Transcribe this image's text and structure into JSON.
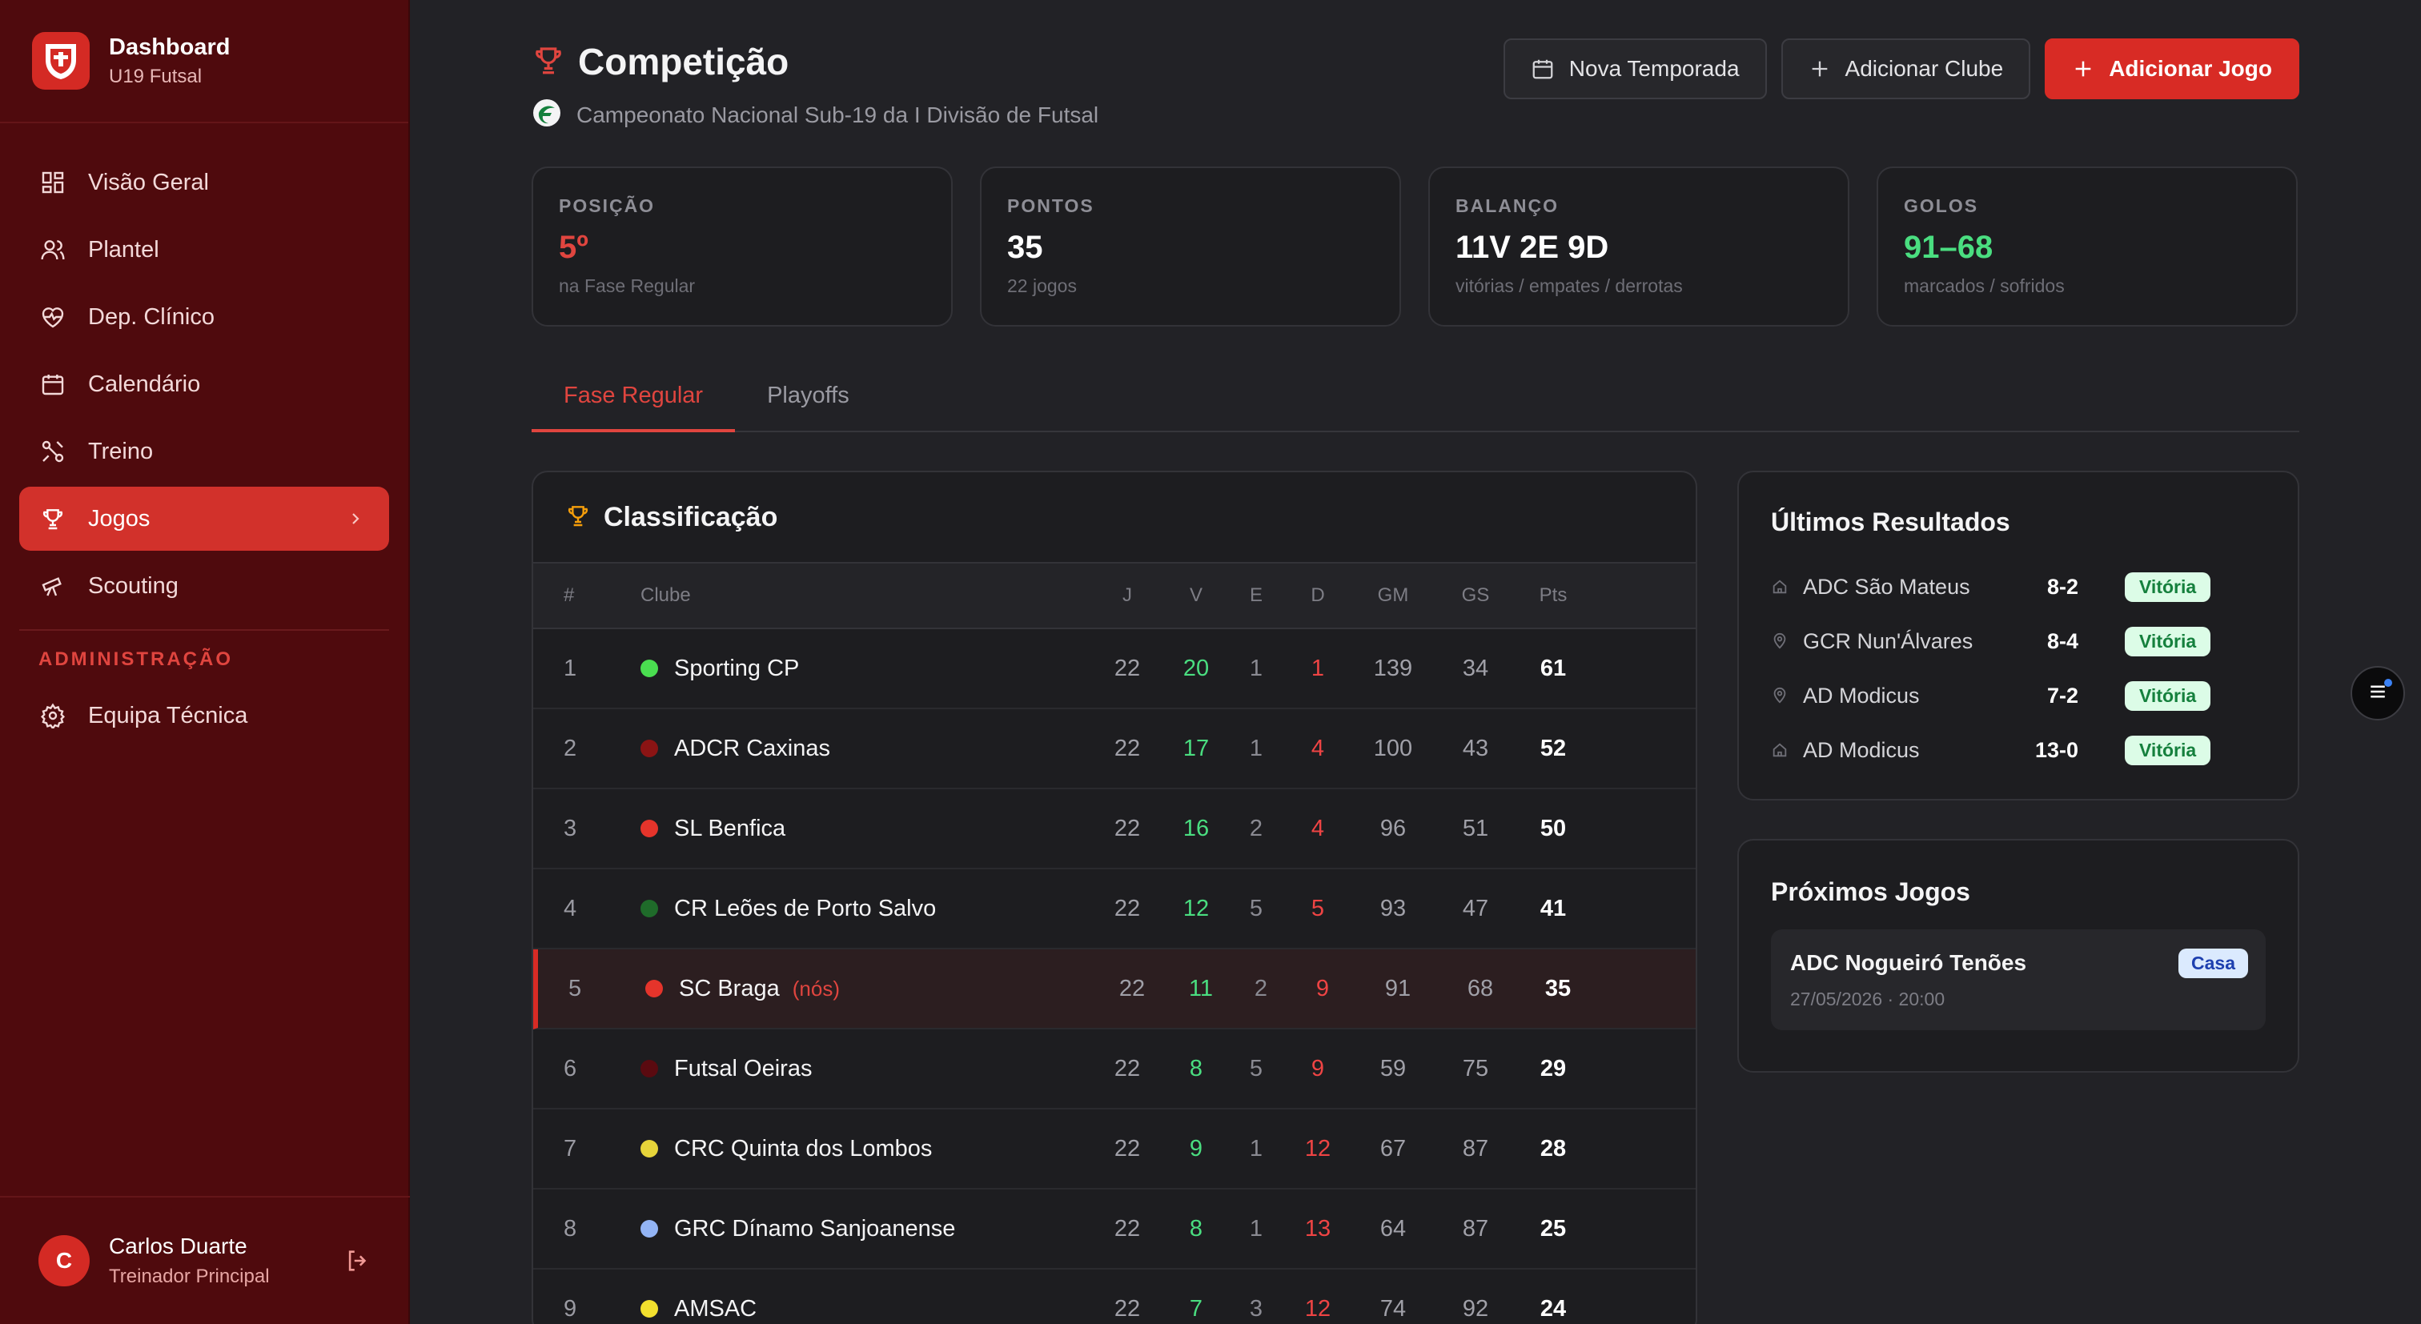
{
  "sidebar": {
    "brand": {
      "title": "Dashboard",
      "subtitle": "U19 Futsal"
    },
    "items": [
      {
        "label": "Visão Geral",
        "icon": "grid-icon"
      },
      {
        "label": "Plantel",
        "icon": "users-icon"
      },
      {
        "label": "Dep. Clínico",
        "icon": "heart-pulse-icon"
      },
      {
        "label": "Calendário",
        "icon": "calendar-icon"
      },
      {
        "label": "Treino",
        "icon": "training-icon"
      },
      {
        "label": "Jogos",
        "icon": "trophy-icon",
        "active": true
      },
      {
        "label": "Scouting",
        "icon": "telescope-icon"
      }
    ],
    "admin_section": "ADMINISTRAÇÃO",
    "admin_items": [
      {
        "label": "Equipa Técnica",
        "icon": "gear-icon"
      }
    ],
    "user": {
      "initial": "C",
      "name": "Carlos Duarte",
      "role": "Treinador Principal"
    }
  },
  "header": {
    "title": "Competição",
    "subtitle": "Campeonato Nacional Sub-19 da I Divisão de Futsal",
    "buttons": {
      "new_season": "Nova Temporada",
      "add_club": "Adicionar Clube",
      "add_game": "Adicionar Jogo"
    }
  },
  "stats": [
    {
      "label": "POSIÇÃO",
      "value": "5º",
      "note": "na Fase Regular",
      "color": "#e0453f"
    },
    {
      "label": "PONTOS",
      "value": "35",
      "note": "22 jogos",
      "color": "#ffffff"
    },
    {
      "label": "BALANÇO",
      "value": "11V 2E 9D",
      "note": "vitórias / empates / derrotas",
      "color": "#ffffff"
    },
    {
      "label": "GOLOS",
      "value": "91–68",
      "note": "marcados / sofridos",
      "color": "#4ade80"
    }
  ],
  "tabs": [
    {
      "label": "Fase Regular",
      "active": true
    },
    {
      "label": "Playoffs"
    }
  ],
  "standings": {
    "title": "Classificação",
    "columns": {
      "pos": "#",
      "club": "Clube",
      "j": "J",
      "v": "V",
      "e": "E",
      "d": "D",
      "gm": "GM",
      "gs": "GS",
      "pts": "Pts"
    },
    "us_tag": "(nós)",
    "rows": [
      {
        "pos": "1",
        "club": "Sporting CP",
        "color": "#4ade50",
        "j": "22",
        "v": "20",
        "e": "1",
        "d": "1",
        "gm": "139",
        "gs": "34",
        "pts": "61"
      },
      {
        "pos": "2",
        "club": "ADCR Caxinas",
        "color": "#8b1414",
        "j": "22",
        "v": "17",
        "e": "1",
        "d": "4",
        "gm": "100",
        "gs": "43",
        "pts": "52"
      },
      {
        "pos": "3",
        "club": "SL Benfica",
        "color": "#e5342b",
        "j": "22",
        "v": "16",
        "e": "2",
        "d": "4",
        "gm": "96",
        "gs": "51",
        "pts": "50"
      },
      {
        "pos": "4",
        "club": "CR Leões de Porto Salvo",
        "color": "#1f6b2a",
        "j": "22",
        "v": "12",
        "e": "5",
        "d": "5",
        "gm": "93",
        "gs": "47",
        "pts": "41"
      },
      {
        "pos": "5",
        "club": "SC Braga",
        "color": "#e5342b",
        "us": true,
        "j": "22",
        "v": "11",
        "e": "2",
        "d": "9",
        "gm": "91",
        "gs": "68",
        "pts": "35"
      },
      {
        "pos": "6",
        "club": "Futsal Oeiras",
        "color": "#5a0a10",
        "j": "22",
        "v": "8",
        "e": "5",
        "d": "9",
        "gm": "59",
        "gs": "75",
        "pts": "29"
      },
      {
        "pos": "7",
        "club": "CRC Quinta dos Lombos",
        "color": "#e6d43a",
        "j": "22",
        "v": "9",
        "e": "1",
        "d": "12",
        "gm": "67",
        "gs": "87",
        "pts": "28"
      },
      {
        "pos": "8",
        "club": "GRC Dínamo Sanjoanense",
        "color": "#93b4f5",
        "j": "22",
        "v": "8",
        "e": "1",
        "d": "13",
        "gm": "64",
        "gs": "87",
        "pts": "25"
      },
      {
        "pos": "9",
        "club": "AMSAC",
        "color": "#f2e02e",
        "j": "22",
        "v": "7",
        "e": "3",
        "d": "12",
        "gm": "74",
        "gs": "92",
        "pts": "24"
      }
    ]
  },
  "results": {
    "title": "Últimos Resultados",
    "items": [
      {
        "team": "ADC São Mateus",
        "score": "8-2",
        "result": "Vitória",
        "icon": "home-icon"
      },
      {
        "team": "GCR Nun'Álvares",
        "score": "8-4",
        "result": "Vitória",
        "icon": "map-pin-icon"
      },
      {
        "team": "AD Modicus",
        "score": "7-2",
        "result": "Vitória",
        "icon": "map-pin-icon"
      },
      {
        "team": "AD Modicus",
        "score": "13-0",
        "result": "Vitória",
        "icon": "home-icon"
      }
    ]
  },
  "upcoming": {
    "title": "Próximos Jogos",
    "items": [
      {
        "team": "ADC Nogueiró Tenões",
        "datetime": "27/05/2026 · 20:00",
        "venue": "Casa"
      }
    ]
  }
}
